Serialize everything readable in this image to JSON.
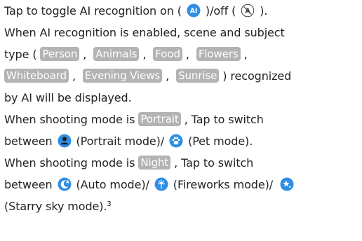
{
  "lines": {
    "l1": {
      "a": "Tap to toggle AI recognition on (",
      "b": ")/off (",
      "c": ")."
    },
    "l2": "When AI recognition is enabled, scene and subject",
    "l3": {
      "a": "type (",
      "sep": ",",
      "sep2": ",",
      "sep3": ","
    },
    "l4": {
      "sep": ",",
      "sep2": ",",
      "c": ") recognized"
    },
    "l5": "by AI will be displayed.",
    "l6": {
      "a": "When shooting mode is",
      "b": ", Tap to switch"
    },
    "l7": {
      "a": "between",
      "b": "(Portrait mode)/",
      "c": "(Pet mode)."
    },
    "l8": {
      "a": "When shooting mode is",
      "b": ", Tap to switch"
    },
    "l9": {
      "a": "between",
      "b": "(Auto mode)/",
      "c": "(Fireworks mode)/"
    },
    "l10": {
      "a": "(Starry sky mode).",
      "footnote": "3"
    }
  },
  "tags": {
    "person": "Person",
    "animals": "Animals",
    "food": "Food",
    "flowers": "Flowers",
    "whiteboard": "Whiteboard",
    "evening_views": "Evening Views",
    "sunrise": "Sunrise",
    "portrait": "Portrait",
    "night": "Night"
  },
  "icons": {
    "ai_on": {
      "name": "ai-on-icon",
      "label": "AI"
    },
    "ai_off": {
      "name": "ai-off-icon"
    },
    "portrait": {
      "name": "portrait-person-icon"
    },
    "pet": {
      "name": "pet-paw-icon"
    },
    "auto": {
      "name": "auto-moon-icon",
      "label": "A"
    },
    "fireworks": {
      "name": "fireworks-icon"
    },
    "starry": {
      "name": "starry-sky-icon"
    }
  },
  "colors": {
    "icon_blue": "#2f8de4",
    "tag_gray": "#b3b3b3",
    "text": "#222222"
  }
}
